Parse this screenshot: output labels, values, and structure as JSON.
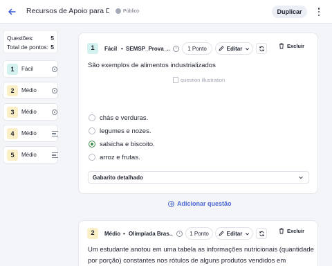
{
  "header": {
    "title": "Recursos de Apoio para Di...",
    "privacy": "Público",
    "duplicate_label": "Duplicar"
  },
  "summary": {
    "questions_label": "Questões:",
    "questions_value": "5",
    "points_label": "Total de pontos:",
    "points_value": "5"
  },
  "sidebar_items": [
    {
      "number": "1",
      "label": "Fácil",
      "type_icon": "radio-icon",
      "color": "#d3f1ee"
    },
    {
      "number": "2",
      "label": "Médio",
      "type_icon": "radio-icon",
      "color": "#fbefc7"
    },
    {
      "number": "3",
      "label": "Médio",
      "type_icon": "radio-icon",
      "color": "#fbefc7"
    },
    {
      "number": "4",
      "label": "Médio",
      "type_icon": "text-lines-icon",
      "color": "#fbefc7"
    },
    {
      "number": "5",
      "label": "Médio",
      "type_icon": "text-lines-icon",
      "color": "#fbefc7"
    }
  ],
  "question1": {
    "number": "1",
    "difficulty": "Fácil",
    "source": "SEMSP_Prova_...",
    "points": "1 Ponto",
    "edit_label": "Editar",
    "delete_label": "Excluir",
    "text": "São exemplos de alimentos industrializados",
    "image_alt": "question illustration",
    "options": [
      {
        "text": "chás e verduras.",
        "selected": false
      },
      {
        "text": "legumes e nozes.",
        "selected": false
      },
      {
        "text": "salsicha e biscoito.",
        "selected": true
      },
      {
        "text": "arroz e frutas.",
        "selected": false
      }
    ],
    "answer_label": "Gabarito detalhado"
  },
  "add_question_label": "Adicionar questão",
  "question2": {
    "number": "2",
    "difficulty": "Médio",
    "source": "Olimpíada Bras...",
    "points": "1 Ponto",
    "edit_label": "Editar",
    "delete_label": "Excluir",
    "text_line1": "Um estudante anotou em uma tabela as informações nutricionais (quantidade",
    "text_line2": "por porção) constantes nos rótulos de alguns produtos vendidos em"
  },
  "colors": {
    "accent": "#4a67d6",
    "easy_chip": "#d3f1ee",
    "medium_chip": "#fbefc7",
    "selected_option": "#3f8f4b"
  }
}
